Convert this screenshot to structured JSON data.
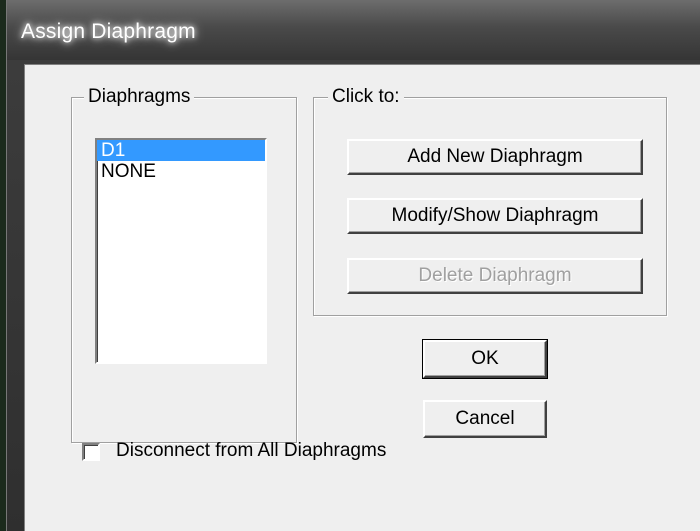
{
  "window": {
    "title": "Assign Diaphragm"
  },
  "diaphragms_group": {
    "label": "Diaphragms",
    "items": [
      {
        "label": "D1",
        "selected": true
      },
      {
        "label": "NONE",
        "selected": false
      }
    ]
  },
  "click_group": {
    "label": "Click to:",
    "add_label": "Add New Diaphragm",
    "modify_label": "Modify/Show Diaphragm",
    "delete_label": "Delete Diaphragm",
    "delete_enabled": false
  },
  "buttons": {
    "ok_label": "OK",
    "cancel_label": "Cancel"
  },
  "disconnect": {
    "label": "Disconnect from All Diaphragms",
    "checked": false
  },
  "colors": {
    "selection": "#3399ff",
    "dialog_face": "#efefef"
  }
}
